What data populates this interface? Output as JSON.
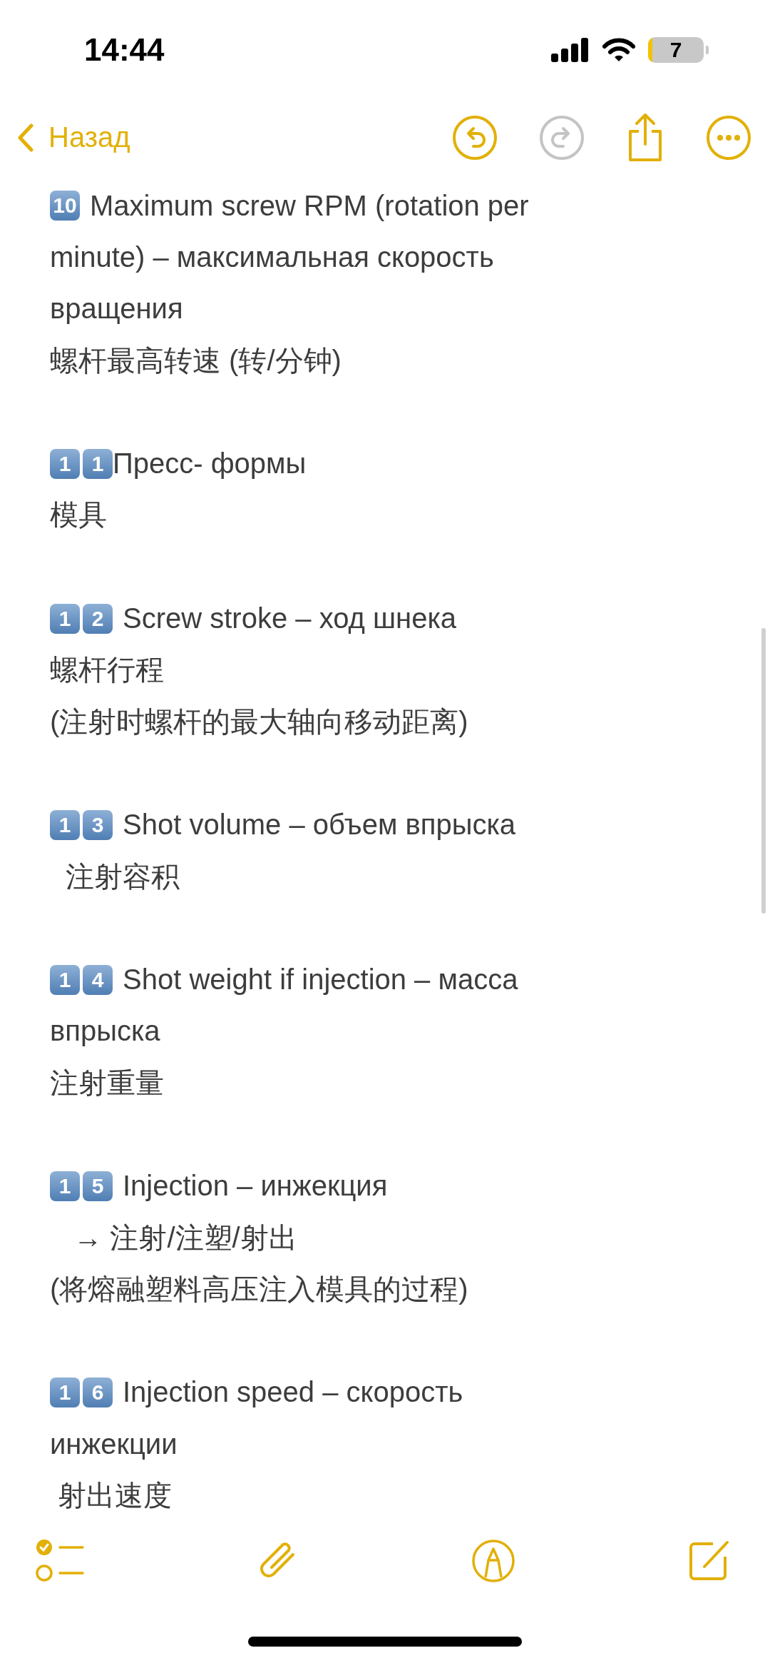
{
  "status_bar": {
    "time": "14:44",
    "battery": "7"
  },
  "nav": {
    "back": "Назад",
    "buttons": [
      {
        "kind": "undo",
        "disabled": false
      },
      {
        "kind": "redo",
        "disabled": true
      },
      {
        "kind": "share",
        "disabled": false
      },
      {
        "kind": "more",
        "disabled": false
      }
    ]
  },
  "note": [
    {
      "badge": [
        "10"
      ],
      "lines": [
        "Maximum screw RPM (rotation per",
        "minute) – максимальная скорость",
        "вращения",
        "螺杆最高转速 (转/分钟)"
      ]
    },
    {
      "badge": [
        "1",
        "1"
      ],
      "lines": [
        "Пресс- формы",
        "模具"
      ]
    },
    {
      "badge": [
        "1",
        "2"
      ],
      "lines": [
        "Screw stroke – ход шнека",
        "螺杆行程",
        "(注射时螺杆的最大轴向移动距离)"
      ]
    },
    {
      "badge": [
        "1",
        "3"
      ],
      "lines": [
        "Shot volume – объем впрыска",
        "  注射容积"
      ]
    },
    {
      "badge": [
        "1",
        "4"
      ],
      "lines": [
        "Shot weight if injection – масса",
        "впрыска",
        "注射重量"
      ]
    },
    {
      "badge": [
        "1",
        "5"
      ],
      "lines": [
        "Injection – инжекция",
        "   → 注射/注塑/射出",
        "(将熔融塑料高压注入模具的过程)"
      ]
    },
    {
      "badge": [
        "1",
        "6"
      ],
      "lines": [
        "Injection speed – скорость",
        "инжекции",
        " 射出速度"
      ]
    }
  ],
  "toolbar": [
    {
      "kind": "checklist"
    },
    {
      "kind": "attach"
    },
    {
      "kind": "markup"
    },
    {
      "kind": "compose"
    }
  ]
}
